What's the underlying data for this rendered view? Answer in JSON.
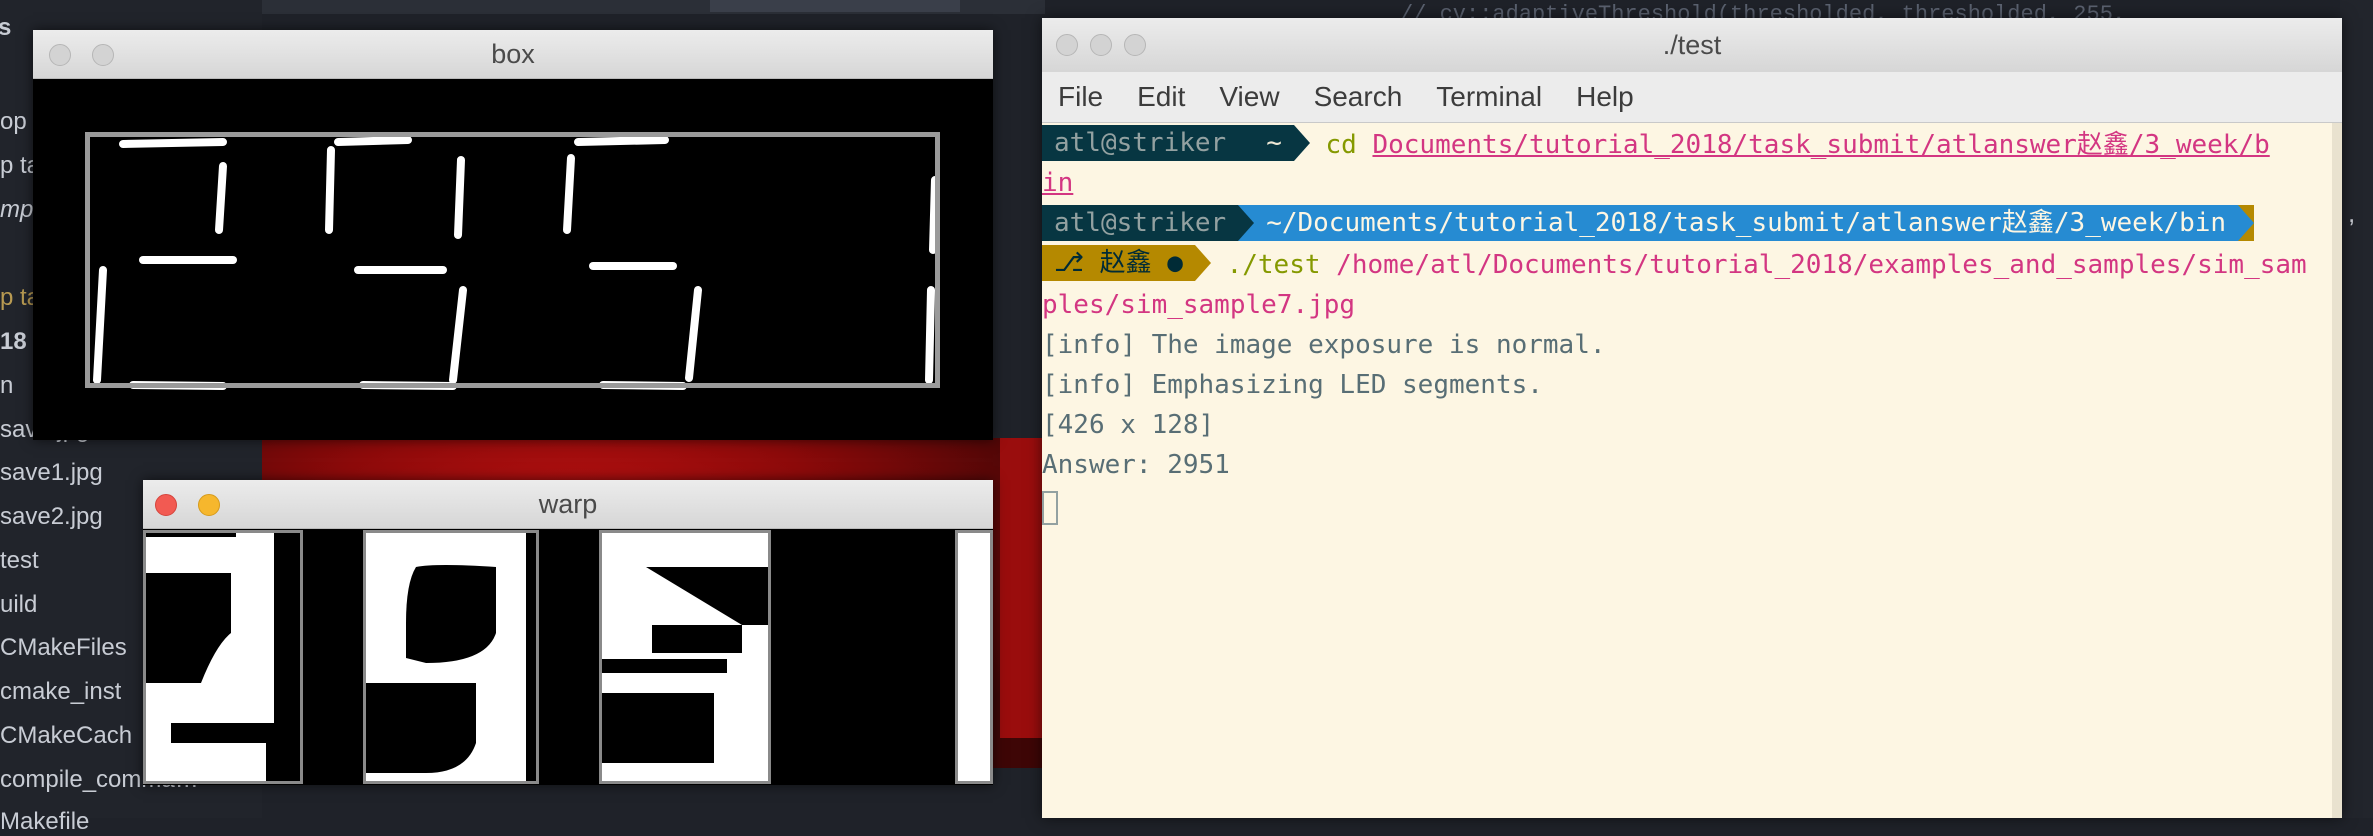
{
  "background": {
    "code_snippet": "// cv::adaptiveThreshold(thresholded, thresholded, 255,",
    "file_tree": [
      {
        "label": "s"
      },
      {
        "label": "op t"
      },
      {
        "label": "p ta"
      },
      {
        "label": "mpl"
      },
      {
        "label": "p ta"
      },
      {
        "label": "18"
      },
      {
        "label": "n"
      },
      {
        "label": "save.jpg"
      },
      {
        "label": "save1.jpg"
      },
      {
        "label": "save2.jpg"
      },
      {
        "label": "test"
      },
      {
        "label": "uild"
      },
      {
        "label": "CMakeFiles"
      },
      {
        "label": "cmake_inst"
      },
      {
        "label": "CMakeCach"
      },
      {
        "label": "compile_comma…"
      },
      {
        "label": "Makefile"
      }
    ],
    "comma": ","
  },
  "box_window": {
    "title": "box"
  },
  "warp_window": {
    "title": "warp"
  },
  "terminal": {
    "title": "./test",
    "menu": [
      "File",
      "Edit",
      "View",
      "Search",
      "Terminal",
      "Help"
    ],
    "prompt1": {
      "user": "atl@striker",
      "dir": "~",
      "command": "cd",
      "arg_part1": "Documents/tutorial_2018/task_submit/atlanswer赵鑫/3_week/b",
      "arg_part2": "in"
    },
    "prompt2": {
      "user": "atl@striker",
      "dir": "~/Documents/tutorial_2018/task_submit/atlanswer赵鑫/3_week/bin",
      "git_branch": "赵鑫 ●",
      "command": "./test",
      "arg_part1": "/home/atl/Documents/tutorial_2018/examples_and_samples/sim_sam",
      "arg_part2": "ples/sim_sample7.jpg"
    },
    "output": [
      "[info] The image exposure is normal.",
      "[info] Emphasizing LED segments.",
      "[426 x 128]",
      "Answer: 2951"
    ]
  },
  "colors": {
    "terminal_bg": "#fdf6e3",
    "prompt_dark": "#073642",
    "prompt_blue": "#268bd2",
    "prompt_git": "#b58900",
    "link_magenta": "#d33682",
    "cmd_green": "#859900"
  }
}
